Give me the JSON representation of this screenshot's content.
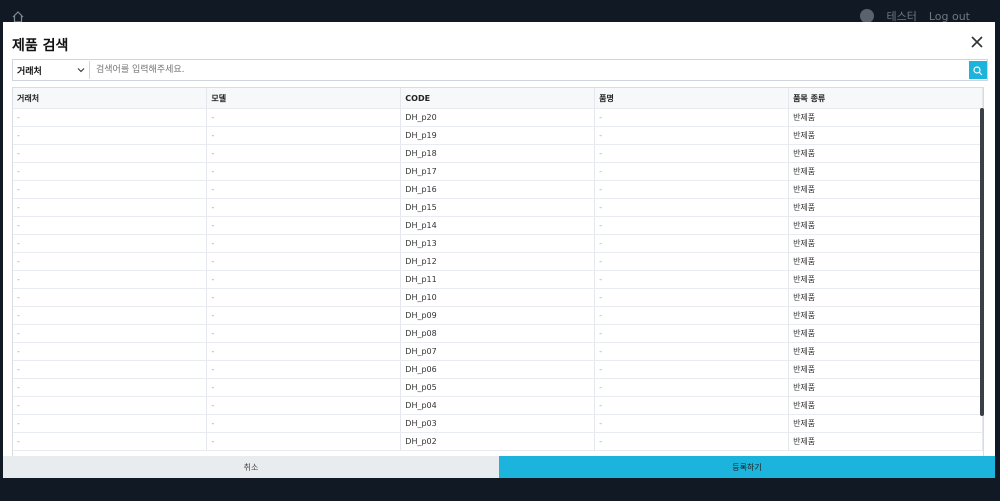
{
  "topbar": {
    "user_name": "테스터",
    "logout_label": "Log out"
  },
  "modal": {
    "title": "제품 검색",
    "search": {
      "select_value": "거래처",
      "placeholder": "검색어를 입력해주세요."
    },
    "table": {
      "columns": [
        "거래처",
        "모델",
        "CODE",
        "품명",
        "품목 종류"
      ],
      "rows": [
        [
          "-",
          "-",
          "DH_p20",
          "-",
          "반제품"
        ],
        [
          "-",
          "-",
          "DH_p19",
          "-",
          "반제품"
        ],
        [
          "-",
          "-",
          "DH_p18",
          "-",
          "반제품"
        ],
        [
          "-",
          "-",
          "DH_p17",
          "-",
          "반제품"
        ],
        [
          "-",
          "-",
          "DH_p16",
          "-",
          "반제품"
        ],
        [
          "-",
          "-",
          "DH_p15",
          "-",
          "반제품"
        ],
        [
          "-",
          "-",
          "DH_p14",
          "-",
          "반제품"
        ],
        [
          "-",
          "-",
          "DH_p13",
          "-",
          "반제품"
        ],
        [
          "-",
          "-",
          "DH_p12",
          "-",
          "반제품"
        ],
        [
          "-",
          "-",
          "DH_p11",
          "-",
          "반제품"
        ],
        [
          "-",
          "-",
          "DH_p10",
          "-",
          "반제품"
        ],
        [
          "-",
          "-",
          "DH_p09",
          "-",
          "반제품"
        ],
        [
          "-",
          "-",
          "DH_p08",
          "-",
          "반제품"
        ],
        [
          "-",
          "-",
          "DH_p07",
          "-",
          "반제품"
        ],
        [
          "-",
          "-",
          "DH_p06",
          "-",
          "반제품"
        ],
        [
          "-",
          "-",
          "DH_p05",
          "-",
          "반제품"
        ],
        [
          "-",
          "-",
          "DH_p04",
          "-",
          "반제품"
        ],
        [
          "-",
          "-",
          "DH_p03",
          "-",
          "반제품"
        ],
        [
          "-",
          "-",
          "DH_p02",
          "-",
          "반제품"
        ]
      ]
    },
    "footer": {
      "cancel_label": "취소",
      "submit_label": "등록하기"
    }
  },
  "colors": {
    "accent": "#1cb3dd",
    "backdrop": "#111a24"
  },
  "icons": {
    "home": "home-icon",
    "close": "close-icon",
    "search": "search-icon",
    "dropdown": "chevron-down-icon"
  }
}
